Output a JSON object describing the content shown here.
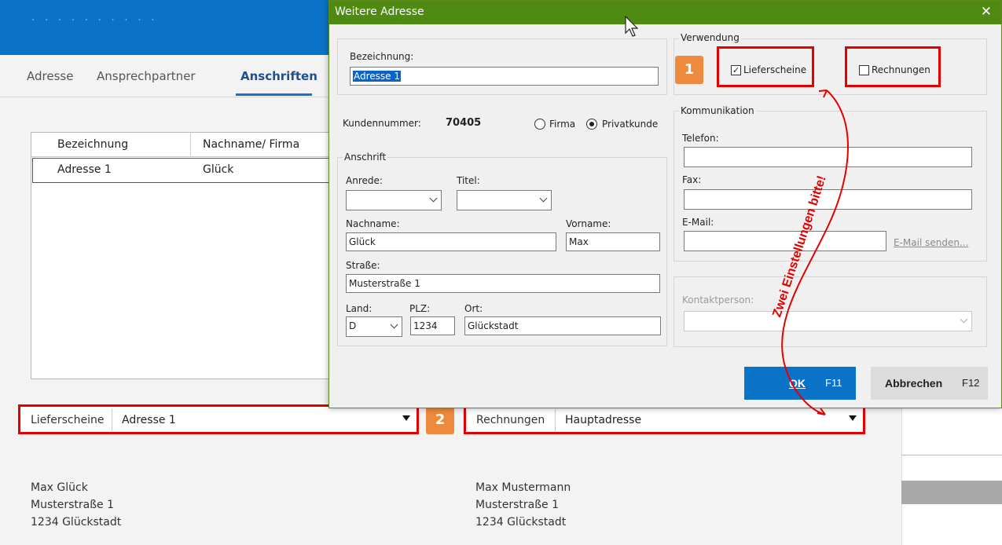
{
  "app": {
    "tabs": [
      {
        "label": "Adresse"
      },
      {
        "label": "Ansprechpartner"
      },
      {
        "label": "Anschriften"
      }
    ],
    "grid": {
      "columns": [
        "Bezeichnung",
        "Nachname/ Firma"
      ],
      "rows": [
        {
          "bezeichnung": "Adresse 1",
          "nachname": "Glück"
        }
      ]
    },
    "lieferscheine": {
      "label": "Lieferscheine",
      "value": "Adresse 1"
    },
    "rechnungen": {
      "label": "Rechnungen",
      "value": "Hauptadresse"
    },
    "badge1": "1",
    "badge2": "2",
    "address_left": [
      "Max Glück",
      "Musterstraße 1",
      "1234 Glückstadt"
    ],
    "address_right": [
      "Max Mustermann",
      "Musterstraße 1",
      "1234 Glückstadt"
    ]
  },
  "dialog": {
    "title": "Weitere Adresse",
    "close": "✕",
    "bezeichnung_label": "Bezeichnung:",
    "bezeichnung_value": "Adresse 1",
    "kundennummer_label": "Kundennummer:",
    "kundennummer_value": "70405",
    "firma_label": "Firma",
    "privatkunde_label": "Privatkunde",
    "customer_type": "Privatkunde",
    "anschrift_title": "Anschrift",
    "anrede_label": "Anrede:",
    "titel_label": "Titel:",
    "nachname_label": "Nachname:",
    "nachname_value": "Glück",
    "vorname_label": "Vorname:",
    "vorname_value": "Max",
    "strasse_label": "Straße:",
    "strasse_value": "Musterstraße 1",
    "land_label": "Land:",
    "land_value": "D",
    "plz_label": "PLZ:",
    "plz_value": "1234",
    "ort_label": "Ort:",
    "ort_value": "Glückstadt",
    "verwendung_title": "Verwendung",
    "lieferscheine_label": "Lieferscheine",
    "lieferscheine_checked": true,
    "rechnungen_label": "Rechnungen",
    "rechnungen_checked": false,
    "kommunikation_title": "Kommunikation",
    "telefon_label": "Telefon:",
    "fax_label": "Fax:",
    "email_label": "E-Mail:",
    "email_send_label": "E-Mail senden...",
    "kontaktperson_label": "Kontaktperson:",
    "ok_label": "OK",
    "ok_key": "F11",
    "cancel_label": "Abbrechen",
    "cancel_key": "F12"
  },
  "annotation": {
    "text": "Zwei Einstellungen bitte!",
    "color": "#e20000"
  },
  "colors": {
    "header_blue": "#0a73c7",
    "dialog_green": "#4f8a12",
    "highlight_red": "#e20000",
    "badge_orange": "#ed8a3d"
  }
}
